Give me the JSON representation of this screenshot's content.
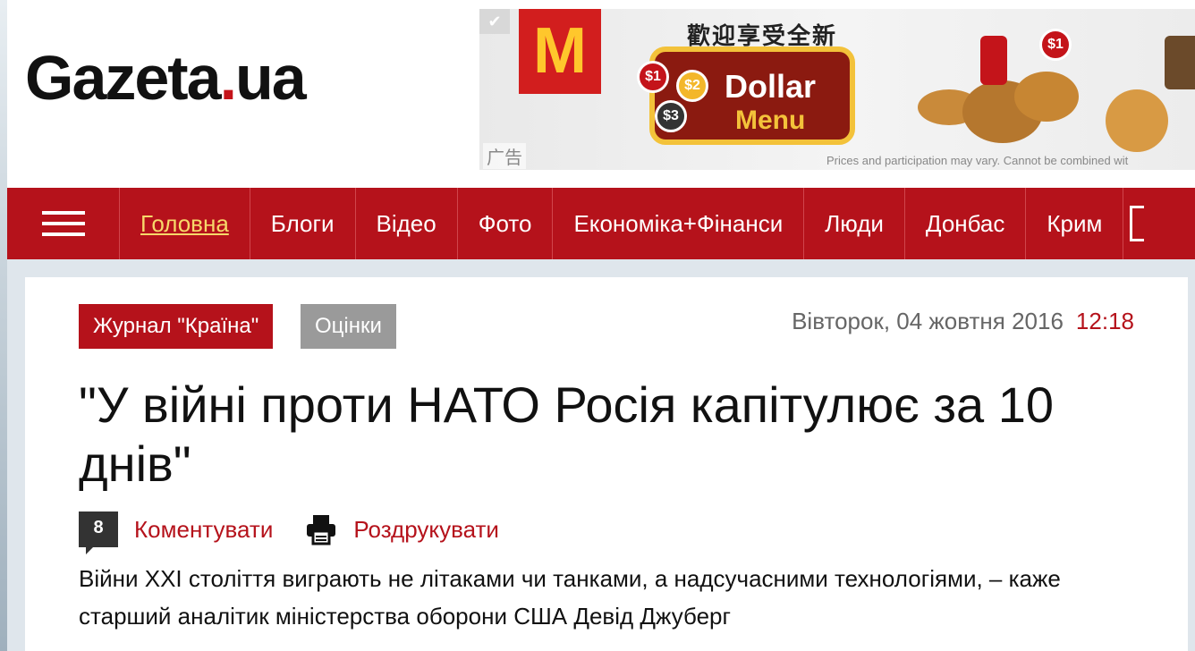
{
  "site": {
    "logo_main": "Gazeta",
    "logo_dot": ".",
    "logo_tld": "ua"
  },
  "ad": {
    "tag": "广告",
    "headline_cn": "歡迎享受全新",
    "dollar": "Dollar",
    "menu": "Menu",
    "coins": [
      "$1",
      "$2",
      "$3",
      "$1"
    ],
    "fine_print": "Prices and participation may vary. Cannot be combined wit"
  },
  "nav": {
    "items": [
      {
        "label": "Головна",
        "active": true
      },
      {
        "label": "Блоги"
      },
      {
        "label": "Відео"
      },
      {
        "label": "Фото"
      },
      {
        "label": "Економіка+Фінанси"
      },
      {
        "label": "Люди"
      },
      {
        "label": "Донбас"
      },
      {
        "label": "Крим"
      }
    ]
  },
  "article": {
    "tag_primary": "Журнал \"Країна\"",
    "tag_secondary": "Оцінки",
    "date": "Вівторок, 04 жовтня 2016",
    "time": "12:18",
    "title": "\"У війні проти НАТО Росія капітулює за 10 днів\"",
    "comment_count": "8",
    "comment_label": "Коментувати",
    "print_label": "Роздрукувати",
    "lead": "Війни XXI століття виграють не літаками чи танками, а надсучасними технологіями, – каже старший аналітик міністерства оборони США Девід Джуберг"
  },
  "colors": {
    "brand_red": "#b5121b",
    "nav_active": "#f7d86a",
    "tag_gray": "#9a9a9a"
  }
}
